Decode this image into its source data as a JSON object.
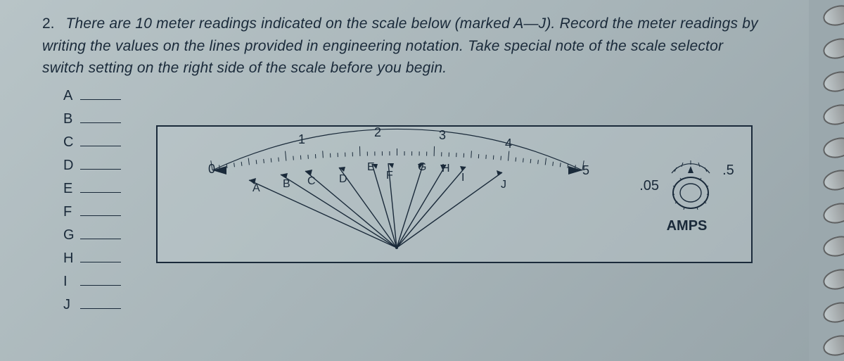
{
  "question": {
    "number": "2.",
    "text": "There are 10 meter readings indicated on the scale below (marked A—J). Record the meter readings by writing the values on the lines provided in engineering notation.  Take special note of the scale selector switch setting on the right side of the scale before you begin."
  },
  "answer_slots": [
    "A",
    "B",
    "C",
    "D",
    "E",
    "F",
    "G",
    "H",
    "I",
    "J"
  ],
  "scale": {
    "end_left": "0",
    "end_right": "5",
    "major_ticks": [
      "1",
      "2",
      "3",
      "4"
    ],
    "needle_labels": [
      "A",
      "B",
      "C",
      "D",
      "E",
      "F",
      "G",
      "H",
      "I",
      "J"
    ]
  },
  "selector": {
    "right_value": ".5",
    "left_value": ".05",
    "unit": "AMPS"
  },
  "chart_data": {
    "type": "other",
    "description": "Analog ammeter arc scale 0–5 with 10 needle pointers labeled A–J. Scale selector knob at right showing .05 and .5 AMPS positions.",
    "scale_range": [
      0,
      5
    ],
    "major_tick_values": [
      0,
      1,
      2,
      3,
      4,
      5
    ],
    "needle_estimates": {
      "A": 0.4,
      "B": 0.8,
      "C": 1.1,
      "D": 1.5,
      "E": 1.95,
      "F": 2.1,
      "G": 2.6,
      "H": 2.9,
      "I": 3.15,
      "J": 3.6
    },
    "selector_positions": [
      ".05",
      ".5"
    ],
    "selector_unit": "AMPS"
  }
}
